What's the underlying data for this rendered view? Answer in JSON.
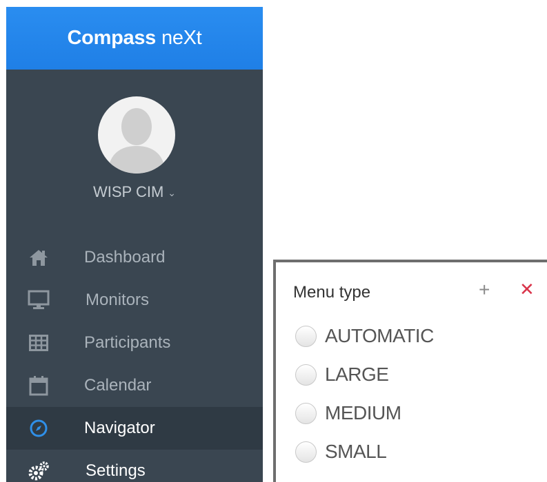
{
  "brand": {
    "part1": "Compass",
    "part2": "neXt"
  },
  "user": {
    "name": "WISP CIM",
    "chevron": "chevron-down-icon"
  },
  "nav": [
    {
      "label": "Dashboard",
      "icon": "home-icon"
    },
    {
      "label": "Monitors",
      "icon": "monitor-icon"
    },
    {
      "label": "Participants",
      "icon": "grid-icon"
    },
    {
      "label": "Calendar",
      "icon": "calendar-icon"
    },
    {
      "label": "Navigator",
      "icon": "compass-icon",
      "active": true
    },
    {
      "label": "Settings",
      "icon": "gears-icon"
    }
  ],
  "menu_panel": {
    "title": "Menu type",
    "add_icon": "plus-icon",
    "close_icon": "close-icon",
    "options": [
      "AUTOMATIC",
      "LARGE",
      "MEDIUM",
      "SMALL"
    ]
  },
  "colors": {
    "sidebar": "#3a4651",
    "brand": "#1f7fe6",
    "active_item": "#2f3a44",
    "close": "#d9344a"
  }
}
